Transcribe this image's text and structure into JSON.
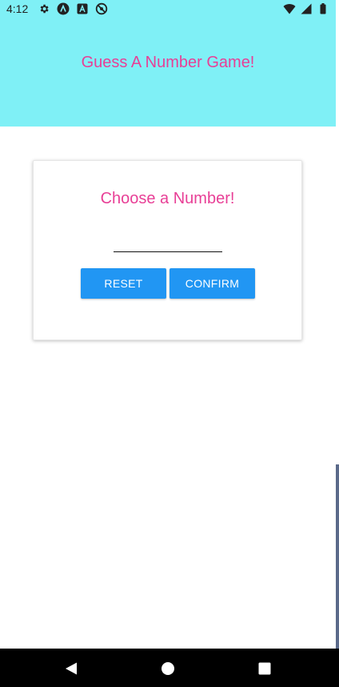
{
  "status_bar": {
    "time": "4:12",
    "icons_left": [
      "settings-icon",
      "app-a-icon",
      "app-a-box-icon",
      "blocked-icon"
    ],
    "icons_right": [
      "wifi-icon",
      "cell-signal-icon",
      "battery-icon"
    ]
  },
  "header": {
    "title": "Guess A Number Game!",
    "background_color": "#7ff0f6",
    "title_color": "#e83f96"
  },
  "card": {
    "title": "Choose a Number!",
    "input": {
      "value": "",
      "placeholder": ""
    },
    "reset_label": "RESET",
    "confirm_label": "CONFIRM",
    "button_color": "#2196f3"
  },
  "nav_bar": {
    "buttons": [
      "back-icon",
      "home-icon",
      "recents-icon"
    ]
  }
}
